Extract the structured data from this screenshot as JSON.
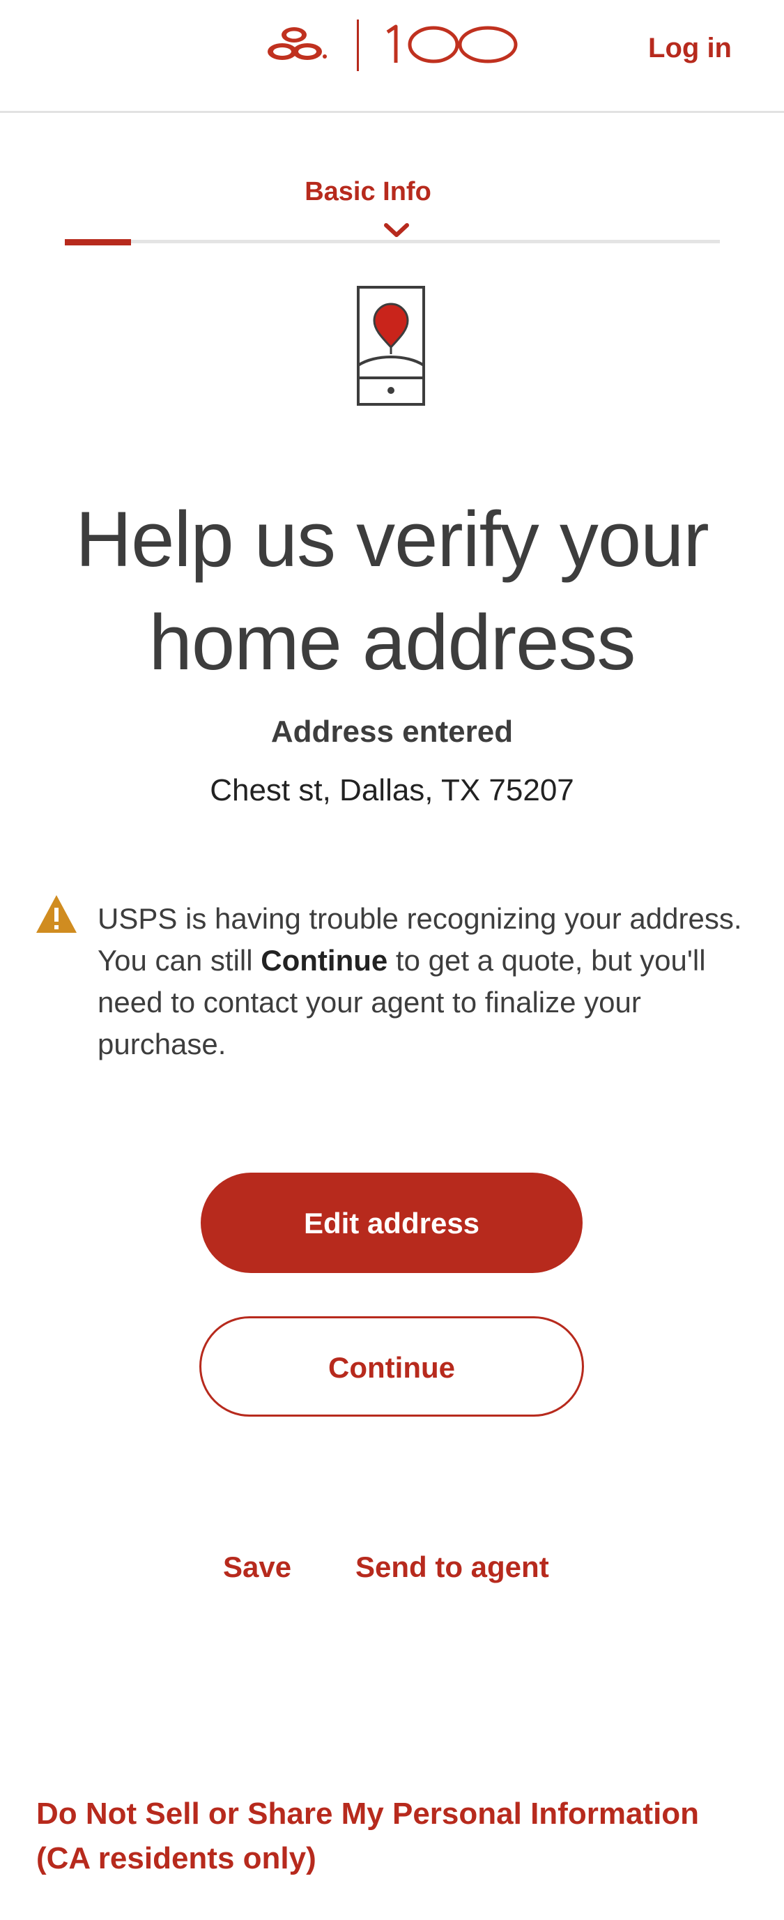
{
  "header": {
    "brand_text": "100",
    "login_label": "Log in",
    "brand_color": "#b72a1d"
  },
  "progress": {
    "step_label": "Basic Info",
    "fraction_complete": 0.1
  },
  "main": {
    "icon": "phone-location-pin-icon",
    "title": "Help us verify your home address",
    "address_label": "Address entered",
    "address_value": "Chest st, Dallas, TX 75207"
  },
  "warning": {
    "icon": "warning-triangle-icon",
    "text_before": "USPS is having trouble recognizing your address. You can still ",
    "text_bold": "Continue",
    "text_after": " to get a quote, but you'll need to contact your agent to finalize your purchase."
  },
  "actions": {
    "edit_label": "Edit address",
    "continue_label": "Continue",
    "save_label": "Save",
    "send_label": "Send to agent"
  },
  "footer": {
    "privacy_line1": "Do Not Sell or Share My Personal Information",
    "privacy_line2": "(CA residents only)"
  }
}
